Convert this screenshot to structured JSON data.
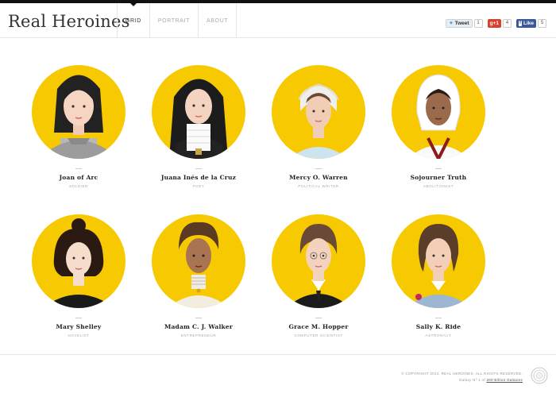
{
  "header": {
    "logo": "Real Heroines",
    "tabs": [
      {
        "label": "GRID"
      },
      {
        "label": "PORTRAIT"
      },
      {
        "label": "ABOUT"
      }
    ],
    "social": {
      "tweet": {
        "label": "Tweet",
        "count": "1"
      },
      "gplus": {
        "label": "g+1",
        "count": "4"
      },
      "like": {
        "label": "Like",
        "count": "5"
      }
    }
  },
  "heroines": [
    {
      "name": "Joan of Arc",
      "role": "SOLDIER"
    },
    {
      "name": "Juana Inés de la Cruz",
      "role": "POET"
    },
    {
      "name": "Mercy O. Warren",
      "role": "POLITICAL WRITER"
    },
    {
      "name": "Sojourner Truth",
      "role": "ABOLITIONIST"
    },
    {
      "name": "Mary Shelley",
      "role": "NOVELIST"
    },
    {
      "name": "Madam C. J. Walker",
      "role": "ENTREPRENEUR"
    },
    {
      "name": "Grace M. Hopper",
      "role": "COMPUTER SCIENTIST"
    },
    {
      "name": "Sally K. Ride",
      "role": "ASTRONAUT"
    }
  ],
  "footer": {
    "copyright": "© COPYRIGHT 2014, REAL HEROINES. ALL RIGHTS RESERVED.",
    "galaxy_prefix": "Galaxy Nº 1 of",
    "galaxy_link": "200 Billion Galaxies"
  },
  "colors": {
    "accent": "#f7c901",
    "top_bar": "#111111"
  }
}
